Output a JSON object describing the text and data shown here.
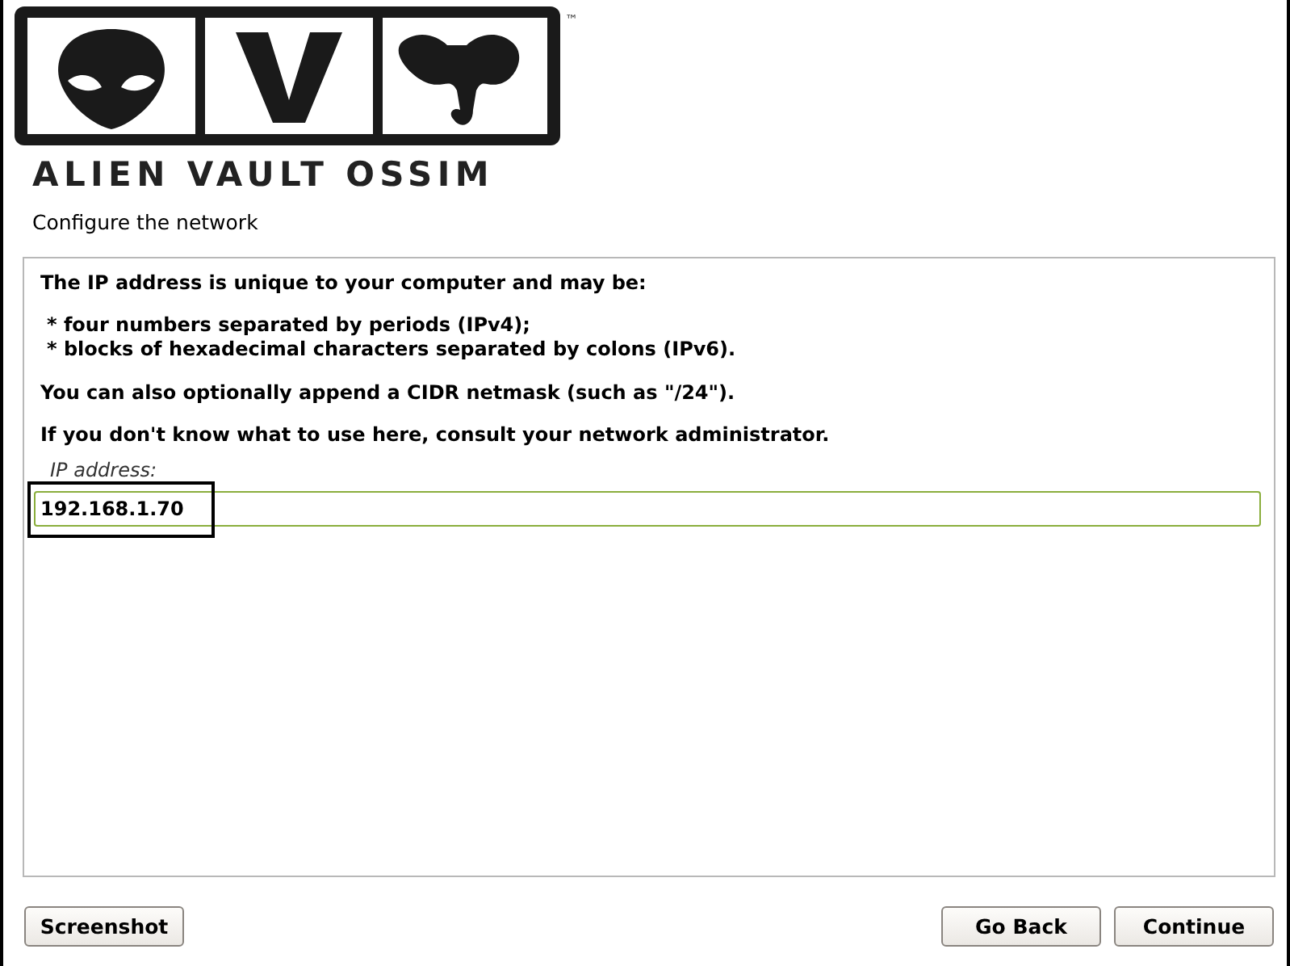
{
  "logo": {
    "wordmark": "ALIEN VAULT OSSIM",
    "trademark": "™"
  },
  "title": "Configure the network",
  "description": {
    "intro": "The IP address is unique to your computer and may be:",
    "bullets": [
      "* four numbers separated by periods (IPv4);",
      "* blocks of hexadecimal characters separated by colons (IPv6)."
    ],
    "paragraphs": [
      "You can also optionally append a CIDR netmask (such as \"/24\").",
      "If you don't know what to use here, consult your network administrator."
    ]
  },
  "field": {
    "label": "IP address:",
    "value": "192.168.1.70",
    "highlighted": true
  },
  "buttons": [
    {
      "label": "Screenshot",
      "kind": "left"
    },
    {
      "label": "Go Back",
      "kind": "right"
    },
    {
      "label": "Continue",
      "kind": "right"
    }
  ]
}
